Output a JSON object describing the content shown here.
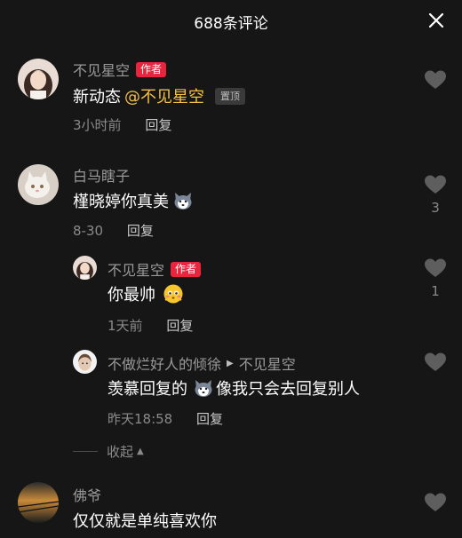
{
  "header": {
    "title": "688条评论"
  },
  "comments": [
    {
      "username": "不见星空",
      "badge": "作者",
      "text": "新动态",
      "mention": "@不见星空",
      "pin": "置顶",
      "time": "3小时前",
      "reply": "回复",
      "likes": ""
    },
    {
      "username": "白马瞎子",
      "text": "槿晓婷你真美",
      "time": "8-30",
      "reply": "回复",
      "likes": "3"
    },
    {
      "username": "不见星空",
      "badge": "作者",
      "text": "你最帅",
      "time": "1天前",
      "reply": "回复",
      "likes": "1"
    },
    {
      "username": "不做烂好人的倾徐",
      "reply_to": "不见星空",
      "text_before": "羡慕回复的",
      "text_after": "像我只会去回复别人",
      "time": "昨天18:58",
      "reply": "回复",
      "likes": ""
    },
    {
      "username": "佛爷",
      "text": "仅仅就是单纯喜欢你",
      "likes": ""
    }
  ],
  "collapse": {
    "label": "收起"
  },
  "colors": {
    "background": "#161616",
    "author_badge": "#e8253d",
    "mention": "#f5c044"
  },
  "icons": [
    "close-icon",
    "heart-icon",
    "husky-emoji-icon",
    "blushing-emoji-icon",
    "caret-up-icon",
    "play-arrow-icon"
  ]
}
